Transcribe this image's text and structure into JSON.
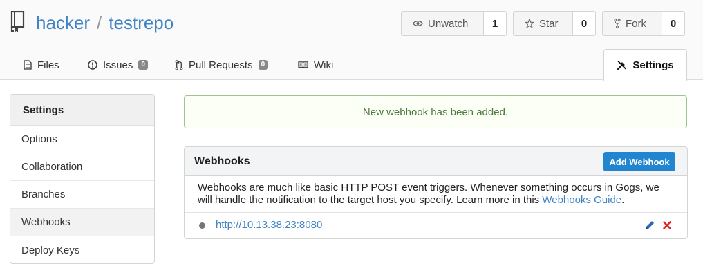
{
  "repo": {
    "owner": "hacker",
    "separator": "/",
    "name": "testrepo"
  },
  "header_buttons": {
    "unwatch": {
      "label": "Unwatch",
      "count": "1"
    },
    "star": {
      "label": "Star",
      "count": "0"
    },
    "fork": {
      "label": "Fork",
      "count": "0"
    }
  },
  "tabs": {
    "files": {
      "label": "Files"
    },
    "issues": {
      "label": "Issues",
      "badge": "0"
    },
    "pulls": {
      "label": "Pull Requests",
      "badge": "0"
    },
    "wiki": {
      "label": "Wiki"
    },
    "settings": {
      "label": "Settings"
    }
  },
  "sidebar": {
    "title": "Settings",
    "items": [
      {
        "label": "Options"
      },
      {
        "label": "Collaboration"
      },
      {
        "label": "Branches"
      },
      {
        "label": "Webhooks"
      },
      {
        "label": "Deploy Keys"
      }
    ]
  },
  "alert": {
    "message": "New webhook has been added."
  },
  "webhooks": {
    "title": "Webhooks",
    "add_button": "Add Webhook",
    "description": "Webhooks are much like basic HTTP POST event triggers. Whenever something occurs in Gogs, we will handle the notification to the target host you specify. Learn more in this",
    "guide_link": "Webhooks Guide",
    "description_end": ".",
    "hooks": [
      {
        "url": "http://10.13.38.23:8080"
      }
    ]
  },
  "colors": {
    "link": "#4183c4",
    "primary_button": "#2185d0",
    "success_text": "#4e7a3a",
    "success_border": "#a3c293",
    "delete": "#db2828"
  },
  "icons": {
    "repo": "book-icon",
    "unwatch": "eye-icon",
    "star": "star-icon",
    "fork": "fork-icon",
    "files": "file-text-icon",
    "issues": "issue-opened-icon",
    "pulls": "git-pull-request-icon",
    "wiki": "book-open-icon",
    "settings": "tools-icon",
    "edit": "pencil-icon",
    "delete": "x-icon"
  }
}
